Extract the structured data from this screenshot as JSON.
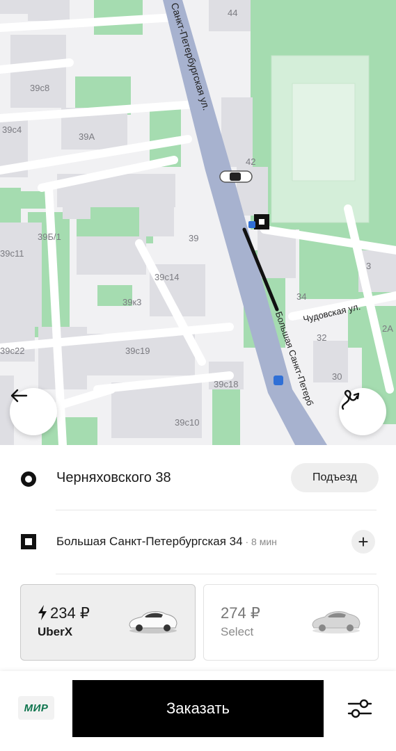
{
  "map": {
    "building_labels": [
      "44",
      "39с8",
      "39с4",
      "39А",
      "42",
      "39Б/1",
      "39",
      "39с11",
      "39с14",
      "39к3",
      "34",
      "3",
      "32",
      "2А",
      "39с22",
      "39с19",
      "30",
      "39с18",
      "39с10"
    ],
    "streets": {
      "main": "Санкт-Петербургская ул.",
      "big": "Большая Санкт-Петерб",
      "side": "Чудовская ул."
    },
    "colors": {
      "road": "#a7b2cf",
      "green": "#a5dcb0",
      "building": "#dedee3",
      "route": "#111111"
    }
  },
  "buttons": {
    "back_icon": "arrow-left-icon",
    "route_icon": "route-icon"
  },
  "pickup": {
    "address": "Черняховского 38",
    "entrance_label": "Подъезд"
  },
  "dropoff": {
    "address": "Большая Санкт-Петербургская 34",
    "separator": " · ",
    "eta": "8 мин",
    "add_icon": "+"
  },
  "rides": [
    {
      "price": "234 ₽",
      "name": "UberX",
      "selected": true,
      "icon": "lightning-icon"
    },
    {
      "price": "274 ₽",
      "name": "Select",
      "selected": false
    }
  ],
  "footer": {
    "payment": "МИР",
    "order_label": "Заказать",
    "settings_icon": "sliders-icon"
  }
}
